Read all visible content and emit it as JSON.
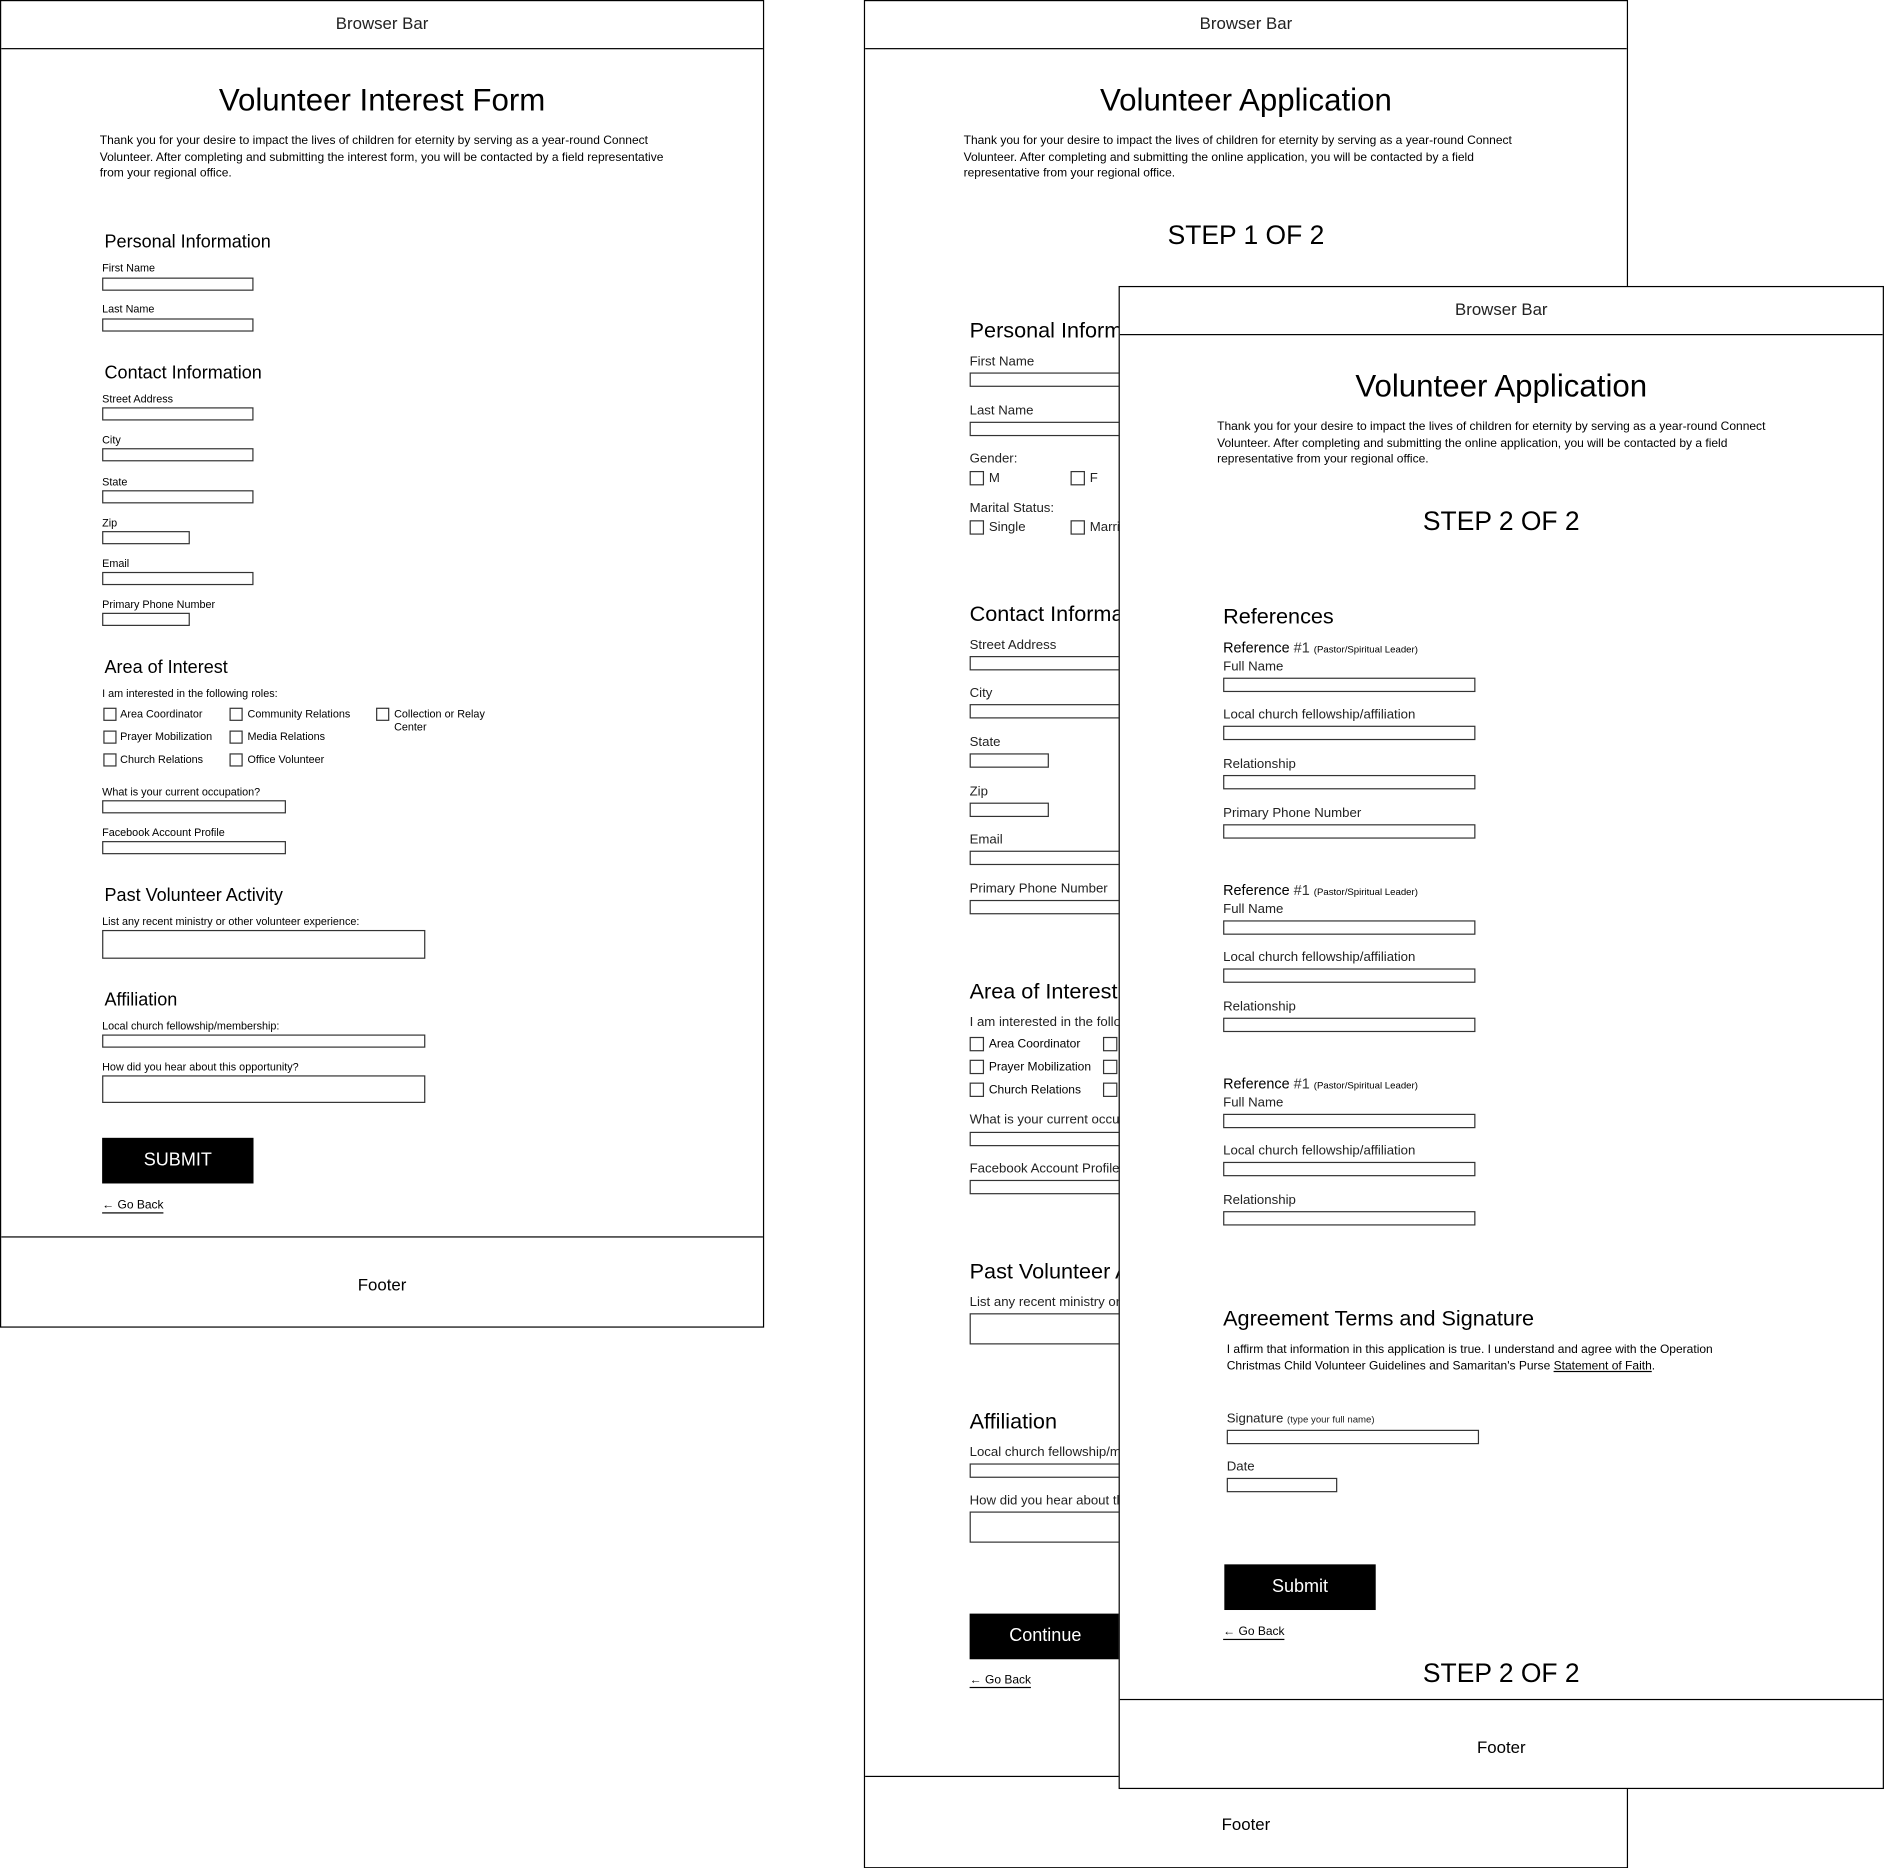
{
  "browser_bar": "Browser Bar",
  "footer": "Footer",
  "go_back": "Go Back",
  "interest_form": {
    "title": "Volunteer Interest Form",
    "intro": "Thank you for your desire to impact the lives of children for eternity by serving as a year-round Connect Volunteer. After completing and submitting the interest form, you will be contacted by a field representative from your regional office.",
    "personal": {
      "heading": "Personal Information",
      "first_name": "First Name",
      "last_name": "Last Name"
    },
    "contact": {
      "heading": "Contact Information",
      "street": "Street Address",
      "city": "City",
      "state": "State",
      "zip": "Zip",
      "email": "Email",
      "phone": "Primary Phone Number"
    },
    "interest": {
      "heading": "Area of Interest",
      "prompt": "I am interested in the following roles:",
      "roles": [
        "Area Coordinator",
        "Community Relations",
        "Collection or Relay Center",
        "Prayer Mobilization",
        "Media Relations",
        "Church Relations",
        "Office Volunteer"
      ],
      "occupation": "What is your current occupation?",
      "facebook": "Facebook Account Profile"
    },
    "past": {
      "heading": "Past Volunteer Activity",
      "prompt": "List any recent ministry or other volunteer experience:"
    },
    "affiliation": {
      "heading": "Affiliation",
      "church": "Local church fellowship/membership:",
      "heard": "How did you hear about this opportunity?"
    },
    "submit": "SUBMIT"
  },
  "application_step1": {
    "title": "Volunteer Application",
    "intro": "Thank you for your desire to impact the lives of children for eternity by serving as a year-round Connect Volunteer. After completing and submitting the online application, you will be contacted by a field representative from your regional office.",
    "step": "STEP 1 OF 2",
    "personal": {
      "heading": "Personal Information",
      "first_name": "First Name",
      "last_name": "Last Name",
      "gender": "Gender:",
      "gender_m": "M",
      "gender_f": "F",
      "marital": "Marital Status:",
      "single": "Single",
      "married": "Married"
    },
    "contact": {
      "heading": "Contact Information",
      "street": "Street Address",
      "city": "City",
      "state": "State",
      "zip": "Zip",
      "email": "Email",
      "phone": "Primary Phone Number"
    },
    "interest": {
      "heading": "Area of Interest",
      "prompt": "I am interested in the following roles:",
      "roles": [
        "Area Coordinator",
        "Prayer Mobilization",
        "Church Relations"
      ],
      "occupation": "What is your current occupation?",
      "facebook": "Facebook Account Profile"
    },
    "past": {
      "heading": "Past Volunteer Activity",
      "prompt": "List any recent ministry or other volunteer experience:"
    },
    "affiliation": {
      "heading": "Affiliation",
      "church": "Local church fellowship/membership:",
      "heard": "How did you hear about this opportunity?"
    },
    "continue": "Continue"
  },
  "application_step2": {
    "title": "Volunteer Application",
    "intro": "Thank you for your desire to impact the lives of children for eternity by serving as a year-round Connect Volunteer. After completing and submitting the online application, you will be contacted by a field representative from your regional office.",
    "step": "STEP 2 OF 2",
    "references_heading": "References",
    "reference_title": "Reference",
    "reference_number": "#1",
    "reference_note": "(Pastor/Spiritual Leader)",
    "full_name": "Full Name",
    "church": "Local church fellowship/affiliation",
    "relationship": "Relationship",
    "phone": "Primary Phone Number",
    "agreement_heading": "Agreement Terms and Signature",
    "agreement_text": "I affirm that information in this application is true. I understand and agree with the Operation Christmas Child Volunteer Guidelines and Samaritan's Purse ",
    "agreement_link": "Statement of Faith",
    "agreement_end": ".",
    "signature": "Signature",
    "signature_note": "(type your full name)",
    "date": "Date",
    "submit": "Submit",
    "step_bottom": "STEP 2 OF 2"
  }
}
